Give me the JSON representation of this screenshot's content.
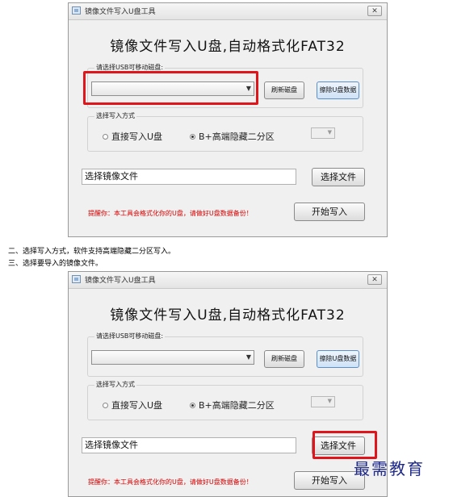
{
  "steps": {
    "step2": "二、选择写入方式，软件支持高端隐藏二分区写入。",
    "step3": "三、选择要导入的镜像文件。"
  },
  "window": {
    "title": "镜像文件写入U盘工具",
    "close_glyph": "✕",
    "heading": "镜像文件写入U盘,自动格式化FAT32",
    "disk_group_label": "请选择USB可移动磁盘:",
    "disk_combo_value": "",
    "combo_arrow": "▼",
    "refresh_label": "刷新磁盘",
    "erase_label": "擦除U盘数据",
    "mode_group_label": "选择写入方式",
    "mode_direct": "直接写入U盘",
    "mode_hidden": "B+高端隐藏二分区",
    "file_value": "选择镜像文件",
    "choose_file_label": "选择文件",
    "warning": "提醒你：本工具会格式化你的U盘，请做好U盘数据备份！",
    "start_label": "开始写入"
  },
  "watermark": "最需教育",
  "colors": {
    "highlight": "#e0141b",
    "warning": "#d40000",
    "watermark": "#1f2a8a"
  },
  "icons": {
    "app": "app-window-icon",
    "close": "close-icon",
    "dropdown": "chevron-down-icon"
  }
}
